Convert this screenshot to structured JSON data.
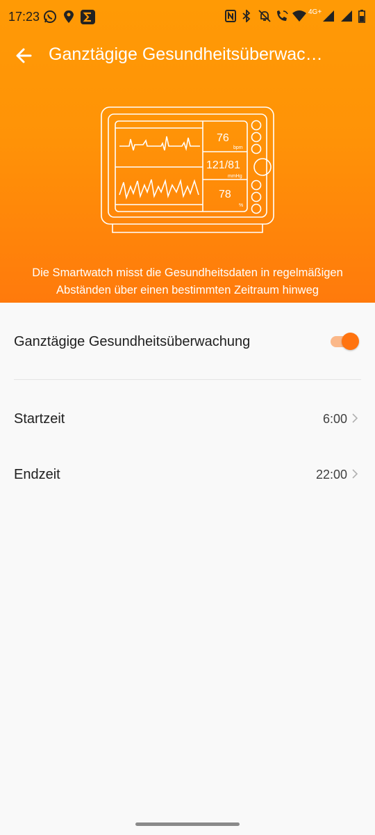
{
  "status_bar": {
    "time": "17:23",
    "left_icons": [
      "whatsapp-icon",
      "location-pin-icon",
      "sigma-app-icon"
    ],
    "right_icons": [
      "nfc-icon",
      "bluetooth-icon",
      "silent-bell-icon",
      "wifi-call-icon",
      "wifi-icon",
      "signal-icon",
      "signal-icon",
      "battery-icon"
    ],
    "network_label": "4G+"
  },
  "appbar": {
    "title": "Ganztägige Gesundheitsüberwac…"
  },
  "illustration": {
    "heart_rate": "76",
    "heart_rate_unit": "bpm",
    "blood_pressure": "121/81",
    "blood_pressure_unit": "mmHg",
    "spo2": "78",
    "spo2_unit": "%"
  },
  "header_description": "Die Smartwatch misst die Gesundheitsdaten in regelmäßigen Abständen über einen bestimmten Zeitraum hinweg",
  "settings": {
    "monitoring": {
      "label": "Ganztägige Gesundheitsüberwachung",
      "enabled": true
    },
    "start_time": {
      "label": "Startzeit",
      "value": "6:00"
    },
    "end_time": {
      "label": "Endzeit",
      "value": "22:00"
    }
  },
  "colors": {
    "accent": "#ff7410",
    "header_top": "#ff9a05",
    "header_bottom": "#ff7a0c"
  }
}
